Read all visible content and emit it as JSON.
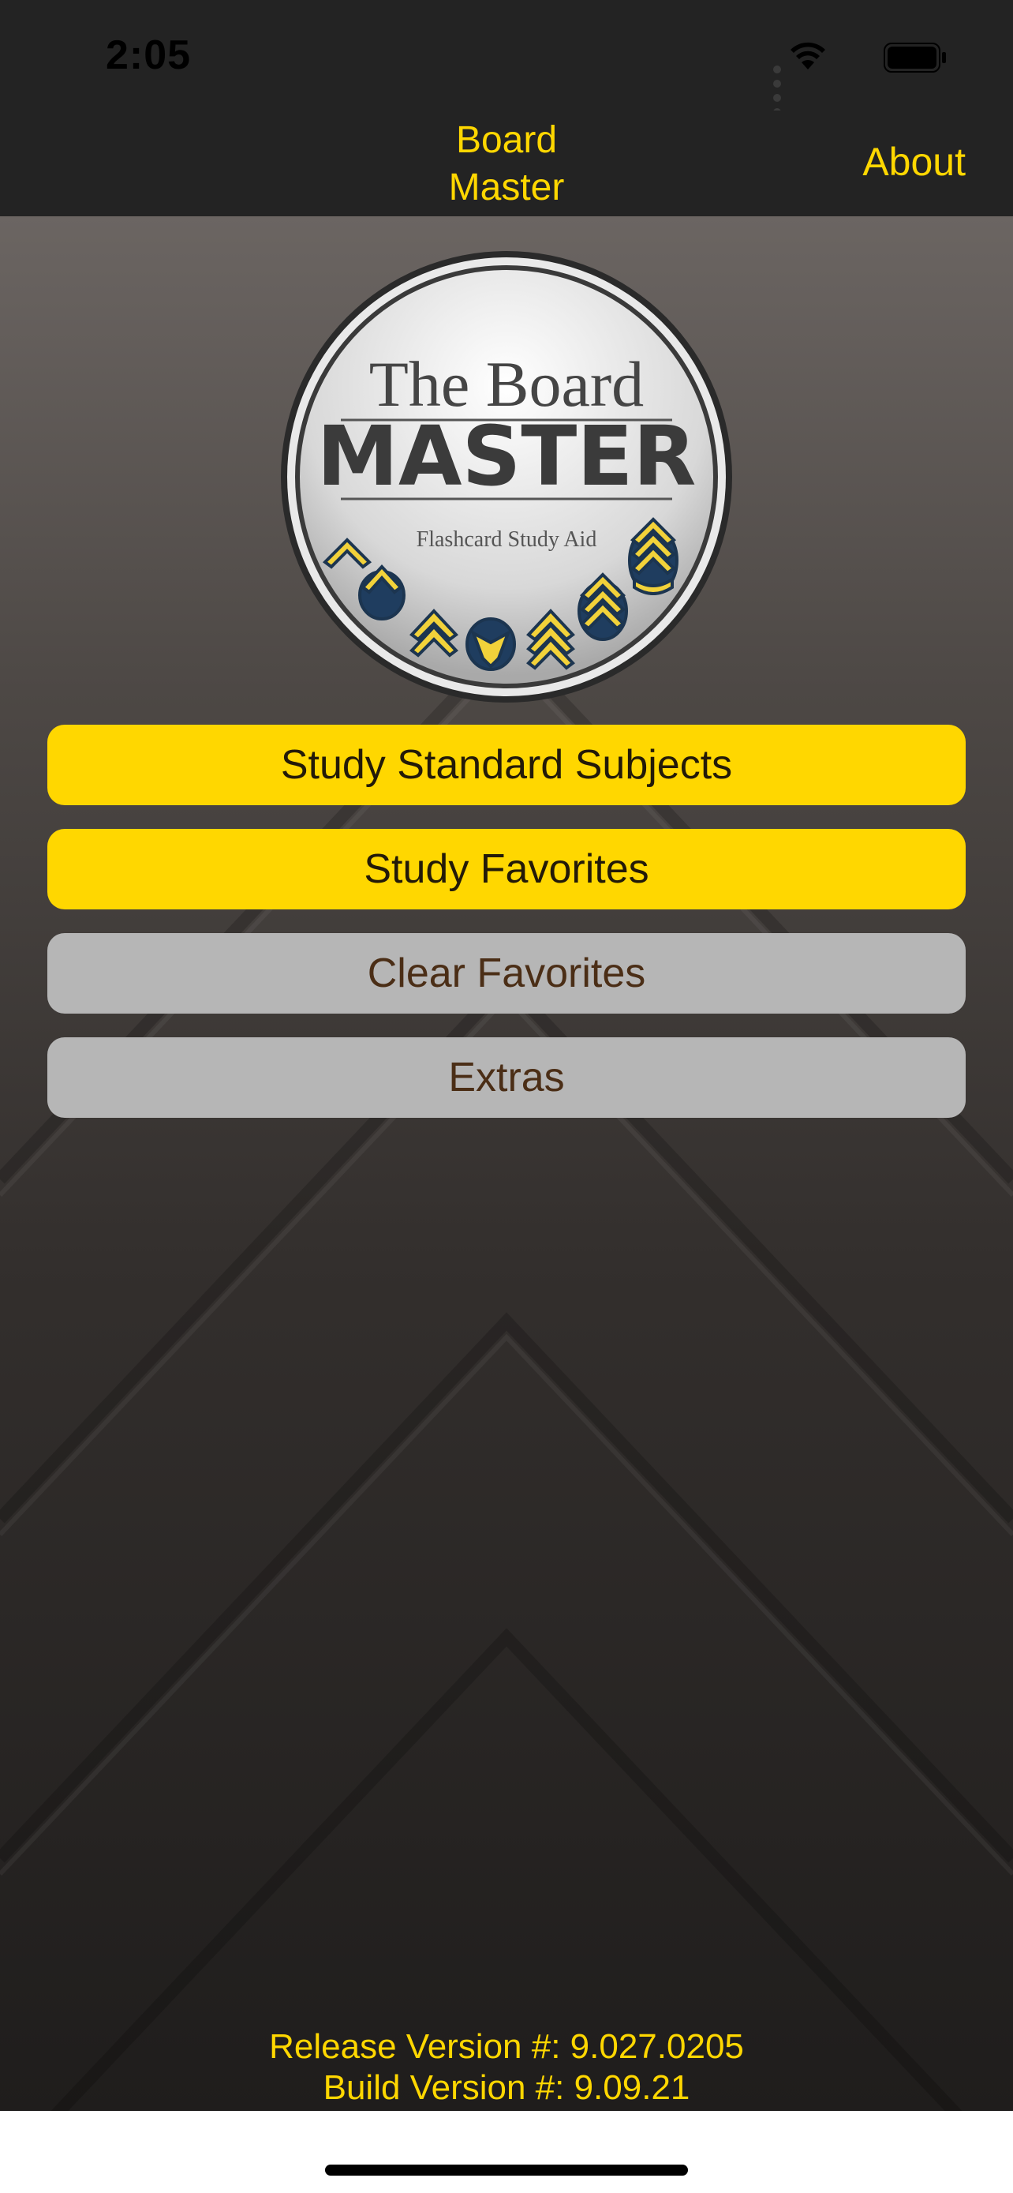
{
  "status_bar": {
    "time": "2:05",
    "icons": [
      "signal-icon",
      "wifi-icon",
      "battery-icon"
    ]
  },
  "nav": {
    "title_line1": "Board",
    "title_line2": "Master",
    "about_label": "About"
  },
  "logo": {
    "line1": "The Board",
    "line2": "MASTER",
    "tagline": "Flashcard Study Aid"
  },
  "menu": {
    "study_standard": "Study Standard Subjects",
    "study_favorites": "Study Favorites",
    "clear_favorites": "Clear Favorites",
    "extras": "Extras"
  },
  "footer": {
    "release": "Release Version #: 9.027.0205",
    "build": "Build Version #: 9.09.21"
  },
  "colors": {
    "accent": "#ffd700",
    "bar": "#232323",
    "button_gray": "#b6b6b6"
  }
}
